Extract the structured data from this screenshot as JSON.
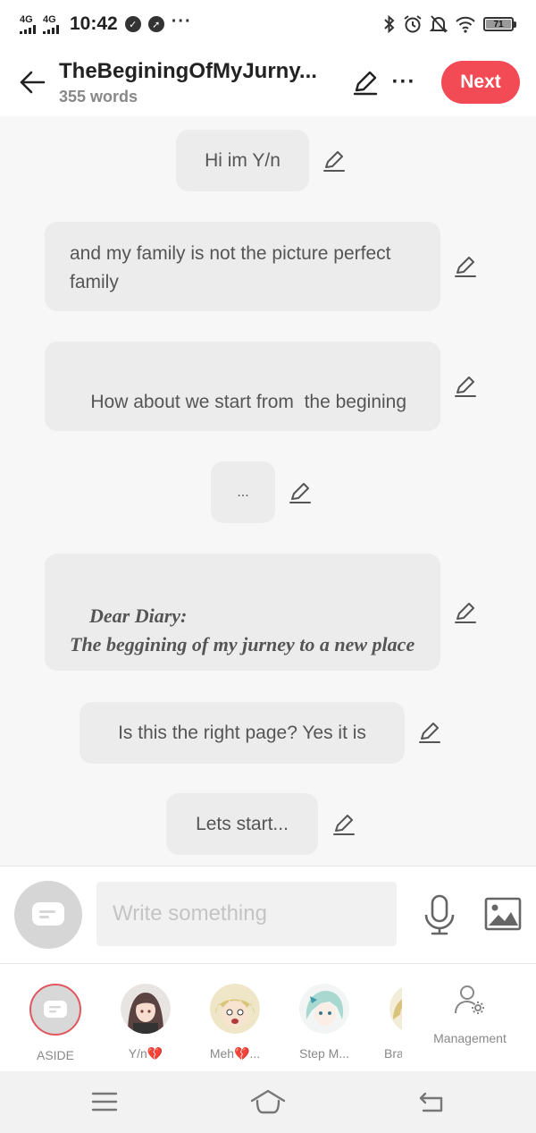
{
  "status_bar": {
    "net1": "4G",
    "net2": "4G",
    "time": "10:42",
    "overflow": "···",
    "battery": "71",
    "icons": [
      "bluetooth-icon",
      "alarm-icon",
      "bell-off-icon",
      "wifi-icon"
    ]
  },
  "header": {
    "title": "TheBeginingOfMyJurny...",
    "word_count": "355 words",
    "more": "···",
    "next_label": "Next",
    "accent": "#f24b55"
  },
  "messages": [
    {
      "text": "Hi im Y/n"
    },
    {
      "text": "and my family is not the picture perfect family"
    },
    {
      "text": "How about we start from  the begining"
    },
    {
      "text": "..."
    },
    {
      "text": "Dear Diary:\nThe beggining of my jurney to a new place"
    },
    {
      "text": "Is this the right page? Yes it is"
    },
    {
      "text": "Lets start..."
    }
  ],
  "compose": {
    "placeholder": "Write something"
  },
  "characters": [
    {
      "label": "ASIDE"
    },
    {
      "label": "Y/n💔"
    },
    {
      "label": "Meh💔..."
    },
    {
      "label": "Step M..."
    },
    {
      "label": "Bra"
    }
  ],
  "management_label": "Management"
}
